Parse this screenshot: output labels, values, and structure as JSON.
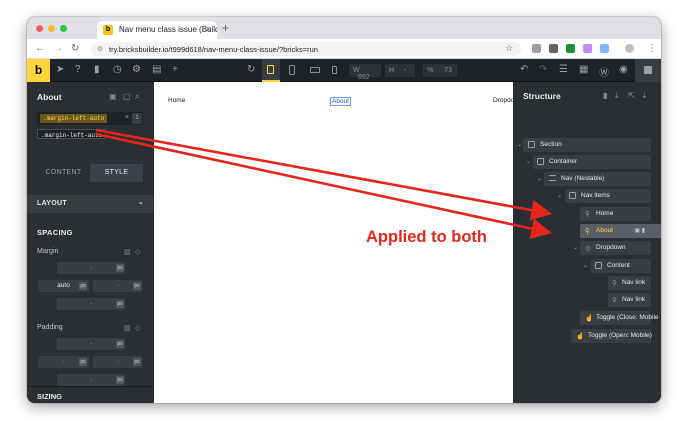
{
  "browser": {
    "tab_title": "Nav menu class issue (Builde",
    "tab_favicon": "b",
    "tab_close": "×",
    "new_tab": "+",
    "url": "try.bricksbuilder.io/t999d618/nav-menu-class-issue/?bricks=run",
    "back_icon": "←",
    "forward_icon": "→",
    "reload_icon": "↻",
    "lock_icon": "⊙",
    "star_icon": "☆",
    "menu_icon": "⋮"
  },
  "toolbar": {
    "logo": "b",
    "width_label": "W",
    "width_value": "992",
    "height_label": "H",
    "height_value": "-",
    "percent_label": "%",
    "percent_value": "73",
    "undo_icon": "↶",
    "redo_icon": "↷",
    "add_icon": "+",
    "refresh_icon": "↻"
  },
  "left_panel": {
    "title": "About",
    "class_chip": ".margin-left-auto",
    "class_clear": "×",
    "class_count": "1",
    "class_tag": ".margin-left-auto",
    "tabs": [
      "CONTENT",
      "STYLE"
    ],
    "layout_section": "LAYOUT",
    "layout_caret": "⌄",
    "spacing_section": "SPACING",
    "margin_label": "Margin",
    "margin_values": {
      "top": "-",
      "left": "auto",
      "right": "-",
      "bottom": "-"
    },
    "padding_label": "Padding",
    "padding_values": {
      "top": "-",
      "left": "-",
      "right": "-",
      "bottom": "-"
    },
    "unit_label": "px",
    "sizing_section": "SIZING"
  },
  "canvas": {
    "nav_items": [
      "Home",
      "About",
      "Dropdown"
    ]
  },
  "structure": {
    "title": "Structure",
    "rows": [
      {
        "label": "Section"
      },
      {
        "label": "Container"
      },
      {
        "label": "Nav (Nestable)"
      },
      {
        "label": "Nav items"
      },
      {
        "label": "Home"
      },
      {
        "label": "About"
      },
      {
        "label": "Dropdown"
      },
      {
        "label": "Content"
      },
      {
        "label": "Nav link"
      },
      {
        "label": "Nav link"
      },
      {
        "label": "Toggle (Close: Mobile"
      },
      {
        "label": "Toggle (Open: Mobile)"
      }
    ]
  },
  "annotation": {
    "text": "Applied to both",
    "color": "#e5261c"
  }
}
